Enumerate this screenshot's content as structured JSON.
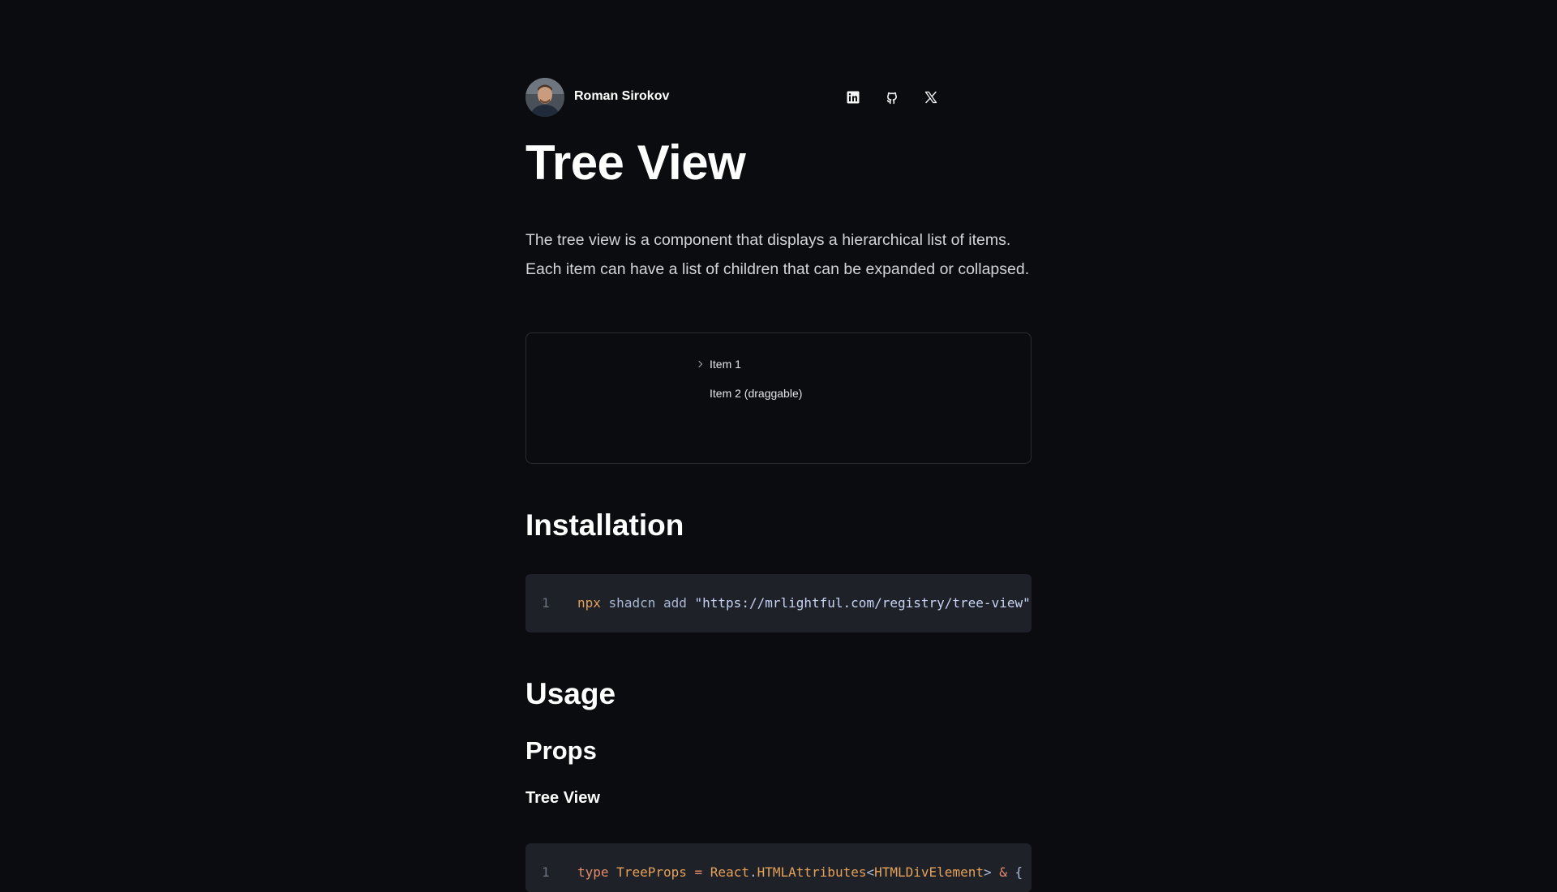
{
  "author": {
    "name": "Roman Sirokov",
    "avatar_icon": "avatar-photo"
  },
  "social": [
    {
      "name": "linkedin",
      "icon": "linkedin-icon"
    },
    {
      "name": "github",
      "icon": "github-icon"
    },
    {
      "name": "x",
      "icon": "x-icon"
    }
  ],
  "page": {
    "title": "Tree View",
    "intro": "The tree view is a component that displays a hierarchical list of items. Each item can have a list of children that can be expanded or collapsed."
  },
  "preview": {
    "items": [
      {
        "label": "Item 1",
        "expandable": true
      },
      {
        "label": "Item 2 (draggable)",
        "expandable": false
      }
    ]
  },
  "installation": {
    "heading": "Installation",
    "code": {
      "line_number": "1",
      "command": "npx",
      "args": "shadcn add",
      "url": "\"https://mrlightful.com/registry/tree-view\""
    }
  },
  "usage": {
    "heading": "Usage",
    "props_heading": "Props",
    "tree_view_heading": "Tree View",
    "code": {
      "line_number": "1",
      "keyword": "type",
      "name": "TreeProps",
      "equals": "=",
      "react": "React",
      "attrs": "HTMLAttributes",
      "lt": "<",
      "generic": "HTMLDivElement",
      "gt": ">",
      "amp": "&",
      "brace": "{"
    }
  },
  "colors": {
    "background": "#0b0c0f",
    "code_background": "#1e2127",
    "border": "#2a2c31",
    "accent_orange": "#e5a159"
  }
}
